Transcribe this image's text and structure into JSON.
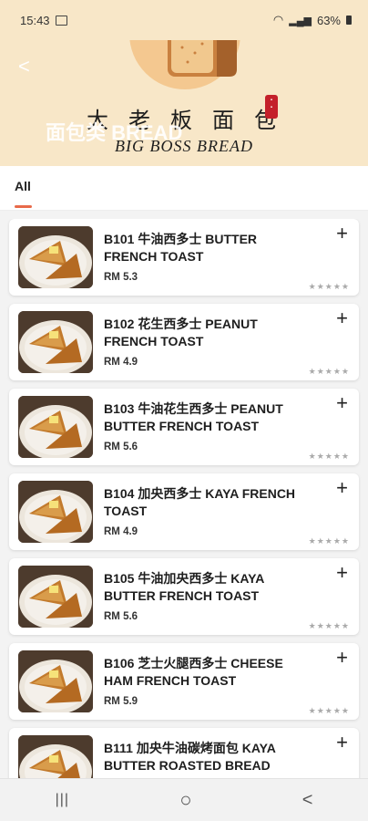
{
  "status_bar": {
    "time": "15:43",
    "battery": "63%"
  },
  "header": {
    "overlay_title": "面包类 BREAD",
    "brand_cn": "大老板面包",
    "brand_en": "BIG BOSS BREAD",
    "back_icon": "<"
  },
  "tabs": [
    {
      "label": "All",
      "active": true
    }
  ],
  "products": [
    {
      "name": "B101 牛油西多士 BUTTER FRENCH TOAST",
      "price": "RM 5.3",
      "rating_stars": "★★★★★"
    },
    {
      "name": "B102 花生西多士 PEANUT FRENCH TOAST",
      "price": "RM 4.9",
      "rating_stars": "★★★★★"
    },
    {
      "name": "B103 牛油花生西多士 PEANUT BUTTER FRENCH TOAST",
      "price": "RM 5.6",
      "rating_stars": "★★★★★"
    },
    {
      "name": "B104 加央西多士 KAYA FRENCH TOAST",
      "price": "RM 4.9",
      "rating_stars": "★★★★★"
    },
    {
      "name": "B105 牛油加央西多士 KAYA BUTTER FRENCH TOAST",
      "price": "RM 5.6",
      "rating_stars": "★★★★★"
    },
    {
      "name": "B106 芝士火腿西多士 CHEESE HAM FRENCH TOAST",
      "price": "RM 5.9",
      "rating_stars": "★★★★★"
    },
    {
      "name": "B111 加央牛油碳烤面包 KAYA BUTTER ROASTED BREAD",
      "price": "",
      "rating_stars": ""
    }
  ],
  "nav": {
    "recents": "|||",
    "home": "○",
    "back": "<"
  }
}
